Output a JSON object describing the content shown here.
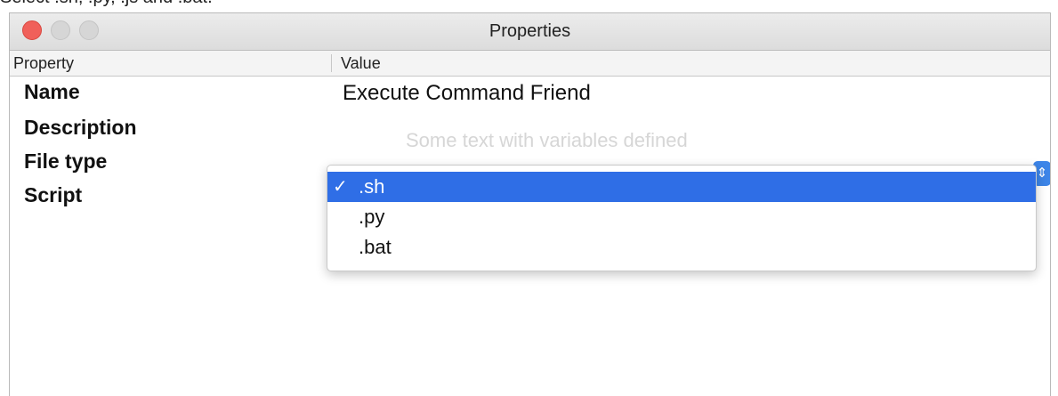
{
  "caption": "Select .sh, .py, .js and .bat.",
  "window": {
    "title": "Properties"
  },
  "table": {
    "columns": [
      "Property",
      "Value"
    ]
  },
  "properties": [
    {
      "label": "Name",
      "value": "Execute Command Friend"
    },
    {
      "label": "Description",
      "value": ""
    },
    {
      "label": "File type",
      "value": ".sh"
    },
    {
      "label": "Script",
      "value": ""
    }
  ],
  "script_placeholder": "Some text with variables defined",
  "file_type_menu": {
    "options": [
      {
        "label": ".sh",
        "selected": true,
        "check": "✓"
      },
      {
        "label": ".py",
        "selected": false
      },
      {
        "label": ".bat",
        "selected": false
      }
    ]
  },
  "colors": {
    "selection": "#2f6ee6",
    "close_button": "#f0605a"
  },
  "icons": {
    "stepper": "up-down-chevron-icon",
    "check": "checkmark-icon"
  }
}
